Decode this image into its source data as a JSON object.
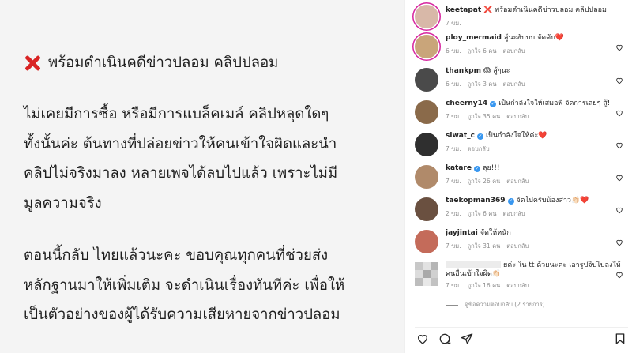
{
  "post_image": {
    "title": "พร้อมดำเนินคดีข่าวปลอม คลิปปลอม",
    "paragraph1": [
      "ไม่เคยมีการซื้อ หรือมีการแบล็คเมล์ คลิปหลุดใดๆ",
      "ทั้งนั้นค่ะ ต้นทางที่ปล่อยข่าวให้คนเข้าใจผิดและนำ",
      "คลิปไม่จริงมาลง หลายเพจได้ลบไปแล้ว เพราะไม่มี",
      "มูลความจริง"
    ],
    "paragraph2": [
      "ตอนนี้กลับ ไทยแล้วนะคะ ขอบคุณทุกคนที่ช่วยส่ง",
      "หลักฐานมาให้เพิ่มเติม จะดำเนินเรื่องทันทีค่ะ เพื่อให้",
      "เป็นตัวอย่างของผู้ได้รับความเสียหายจากข่าวปลอม"
    ]
  },
  "caption": {
    "username": "keetapat",
    "text": "❌ พร้อมดำเนินคดีข่าวปลอม คลิปปลอม",
    "time": "7 ขม."
  },
  "comments": [
    {
      "username": "ploy_mermaid",
      "text": "สู้นะฮับบบ จัดคับ❤️",
      "time": "6 ขม.",
      "likes": "ถูกใจ 6 คน",
      "reply": "ตอบกลับ",
      "verified": false,
      "avatar_color": "#c9a57a"
    },
    {
      "username": "thankpm",
      "text": "😱 สู้ๆนะ",
      "time": "6 ขม.",
      "likes": "ถูกใจ 3 คน",
      "reply": "ตอบกลับ",
      "verified": false,
      "avatar_color": "#4a4a4a"
    },
    {
      "username": "cheerny14",
      "text": "เป็นกำลังใจให้เสมอพี่ จัดการเลยๆ สู้!",
      "time": "7 ขม.",
      "likes": "ถูกใจ 35 คน",
      "reply": "ตอบกลับ",
      "verified": true,
      "avatar_color": "#8a6a4a"
    },
    {
      "username": "siwat_c",
      "text": "เป็นกำลังใจให้ค่ะ❤️",
      "time": "7 ขม.",
      "likes": "",
      "reply": "ตอบกลับ",
      "verified": true,
      "avatar_color": "#2f2f2f"
    },
    {
      "username": "katare",
      "text": "ลุย!!!",
      "time": "7 ขม.",
      "likes": "ถูกใจ 26 คน",
      "reply": "ตอบกลับ",
      "verified": true,
      "avatar_color": "#b08a6a"
    },
    {
      "username": "taekopman369",
      "text": "จัดไปครับน้องสาว👏🏻❤️",
      "time": "2 ขม.",
      "likes": "ถูกใจ 6 คน",
      "reply": "ตอบกลับ",
      "verified": true,
      "avatar_color": "#6a5040"
    },
    {
      "username": "jayjintai",
      "text": "จัดให้หนัก",
      "time": "7 ขม.",
      "likes": "ถูกใจ 31 คน",
      "reply": "ตอบกลับ",
      "verified": false,
      "avatar_color": "#c46b5a"
    },
    {
      "username": "",
      "text": "ยค่ะ ใน tt ด้วยนะคะ เอารูปจิ๊ปไปลงให้คนอื่นเข้าใจผิด👏🏻",
      "time": "7 ขม.",
      "likes": "ถูกใจ 16 คน",
      "reply": "ตอบกลับ",
      "verified": false,
      "avatar_color": "#aaaaaa"
    }
  ],
  "view_replies": "ดูข้อความตอบกลับ (2 รายการ)",
  "icons": {
    "like": "heart-icon",
    "comment": "comment-icon",
    "share": "share-icon",
    "save": "bookmark-icon"
  }
}
